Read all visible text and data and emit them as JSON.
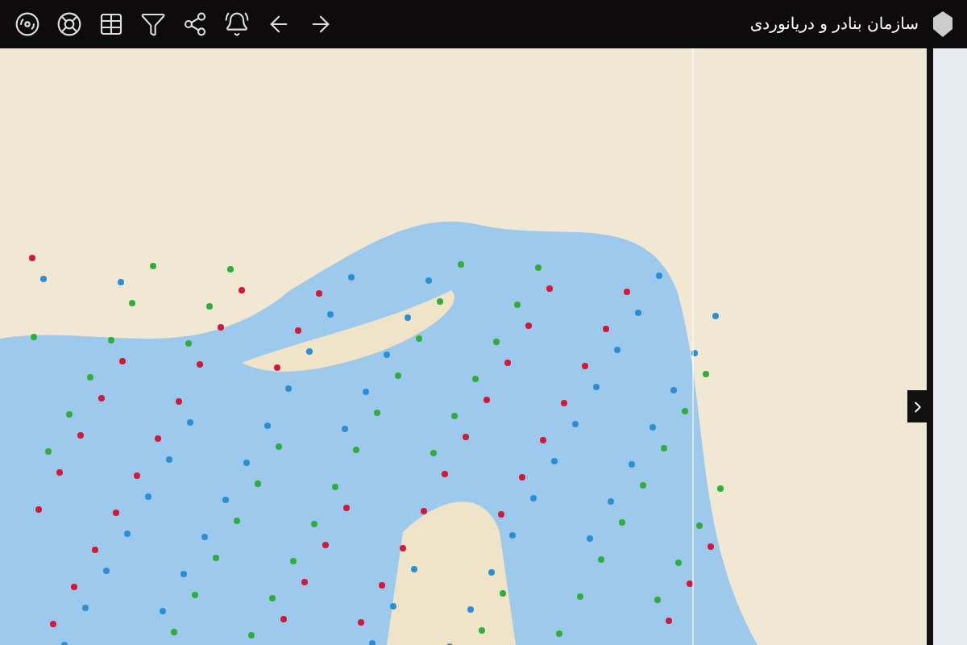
{
  "header": {
    "org_name": "سازمان بنادر و دریانوردی"
  }
}
